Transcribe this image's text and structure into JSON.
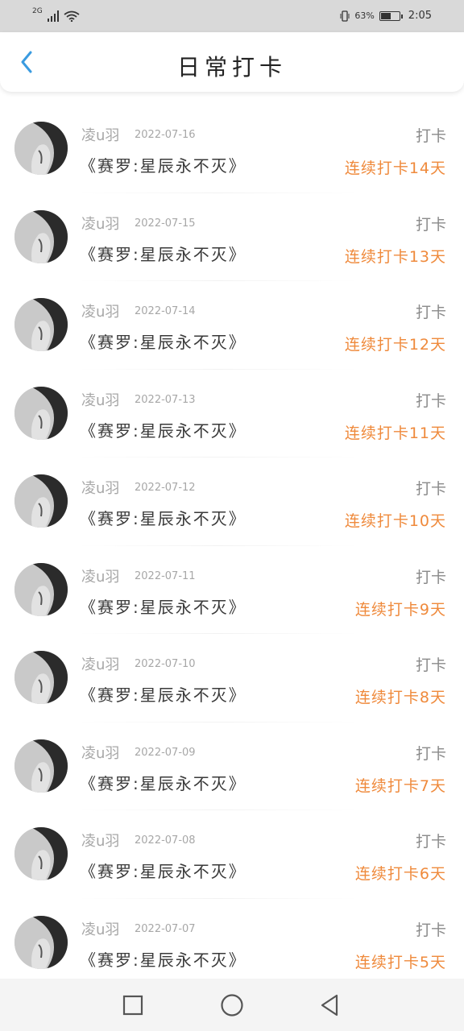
{
  "status_bar": {
    "network": "2G",
    "battery_text": "63%",
    "battery_level": 0.63,
    "time": "2:05",
    "icons": [
      "signal-icon",
      "wifi-icon",
      "vibrate-icon",
      "battery-icon"
    ]
  },
  "header": {
    "title": "日常打卡",
    "back_icon": "chevron-left-icon"
  },
  "colors": {
    "accent_blue": "#3a9be0",
    "streak_orange": "#ef8a3c",
    "muted_gray": "#a7a7a7"
  },
  "records": [
    {
      "user": "凌u羽",
      "date": "2022-07-16",
      "subject": "《赛罗:星辰永不灭》",
      "action": "打卡",
      "streak": "连续打卡14天"
    },
    {
      "user": "凌u羽",
      "date": "2022-07-15",
      "subject": "《赛罗:星辰永不灭》",
      "action": "打卡",
      "streak": "连续打卡13天"
    },
    {
      "user": "凌u羽",
      "date": "2022-07-14",
      "subject": "《赛罗:星辰永不灭》",
      "action": "打卡",
      "streak": "连续打卡12天"
    },
    {
      "user": "凌u羽",
      "date": "2022-07-13",
      "subject": "《赛罗:星辰永不灭》",
      "action": "打卡",
      "streak": "连续打卡11天"
    },
    {
      "user": "凌u羽",
      "date": "2022-07-12",
      "subject": "《赛罗:星辰永不灭》",
      "action": "打卡",
      "streak": "连续打卡10天"
    },
    {
      "user": "凌u羽",
      "date": "2022-07-11",
      "subject": "《赛罗:星辰永不灭》",
      "action": "打卡",
      "streak": "连续打卡9天"
    },
    {
      "user": "凌u羽",
      "date": "2022-07-10",
      "subject": "《赛罗:星辰永不灭》",
      "action": "打卡",
      "streak": "连续打卡8天"
    },
    {
      "user": "凌u羽",
      "date": "2022-07-09",
      "subject": "《赛罗:星辰永不灭》",
      "action": "打卡",
      "streak": "连续打卡7天"
    },
    {
      "user": "凌u羽",
      "date": "2022-07-08",
      "subject": "《赛罗:星辰永不灭》",
      "action": "打卡",
      "streak": "连续打卡6天"
    },
    {
      "user": "凌u羽",
      "date": "2022-07-07",
      "subject": "《赛罗:星辰永不灭》",
      "action": "打卡",
      "streak": "连续打卡5天"
    }
  ],
  "nav_bar": {
    "icons": [
      "recents-square-icon",
      "home-circle-icon",
      "back-triangle-icon"
    ]
  }
}
